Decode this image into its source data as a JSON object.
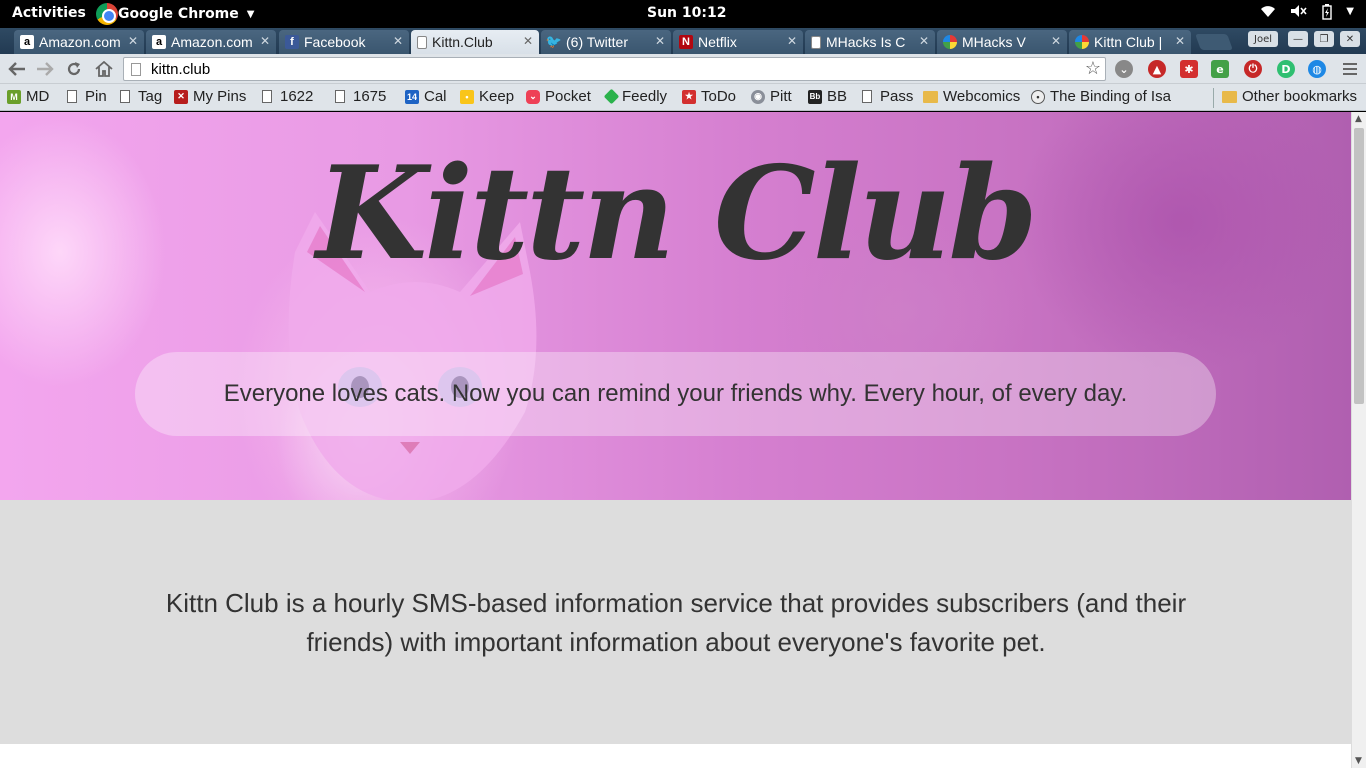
{
  "system_bar": {
    "activities": "Activities",
    "app_name": "Google Chrome",
    "clock": "Sun 10:12"
  },
  "browser": {
    "tabs": [
      {
        "label": "Amazon.com",
        "icon": "amazon-icon"
      },
      {
        "label": "Amazon.com",
        "icon": "amazon-icon"
      },
      {
        "label": "Facebook",
        "icon": "facebook-icon"
      },
      {
        "label": "Kittn.Club",
        "icon": "page-icon",
        "active": true
      },
      {
        "label": "(6) Twitter",
        "icon": "twitter-icon"
      },
      {
        "label": "Netflix",
        "icon": "netflix-icon"
      },
      {
        "label": "MHacks Is C",
        "icon": "page-icon"
      },
      {
        "label": "MHacks V",
        "icon": "mhacks-icon"
      },
      {
        "label": "Kittn Club |",
        "icon": "mhacks-icon"
      }
    ],
    "profile": "Joel",
    "url": "kittn.club",
    "bookmarks": [
      {
        "label": "MD",
        "icon": "gmail-icon"
      },
      {
        "label": "Pin",
        "icon": "page-icon"
      },
      {
        "label": "Tag",
        "icon": "page-icon"
      },
      {
        "label": "My Pins",
        "icon": "pin-icon"
      },
      {
        "label": "1622",
        "icon": "page-icon"
      },
      {
        "label": "1675",
        "icon": "page-icon"
      },
      {
        "label": "Cal",
        "icon": "calendar-icon",
        "badge": "14"
      },
      {
        "label": "Keep",
        "icon": "keep-icon"
      },
      {
        "label": "Pocket",
        "icon": "pocket-icon"
      },
      {
        "label": "Feedly",
        "icon": "feedly-icon"
      },
      {
        "label": "ToDo",
        "icon": "todo-icon"
      },
      {
        "label": "Pitt",
        "icon": "pitt-icon"
      },
      {
        "label": "BB",
        "icon": "bb-icon",
        "badge": "Bb"
      },
      {
        "label": "Pass",
        "icon": "page-icon"
      },
      {
        "label": "Webcomics",
        "icon": "folder-icon"
      },
      {
        "label": "The Binding of Isa",
        "icon": "isaac-icon"
      }
    ],
    "other_bookmarks": "Other bookmarks"
  },
  "page": {
    "hero_title": "Kittn Club",
    "tagline": "Everyone loves cats. Now you can remind your friends why. Every hour, of every day.",
    "about": "Kittn Club is a hourly SMS-based information service that provides subscribers (and their friends) with important information about everyone's favorite pet."
  },
  "colors": {
    "hero_pink": "#e89ae4",
    "about_bg": "#dddddd",
    "text_dark": "#333333"
  }
}
